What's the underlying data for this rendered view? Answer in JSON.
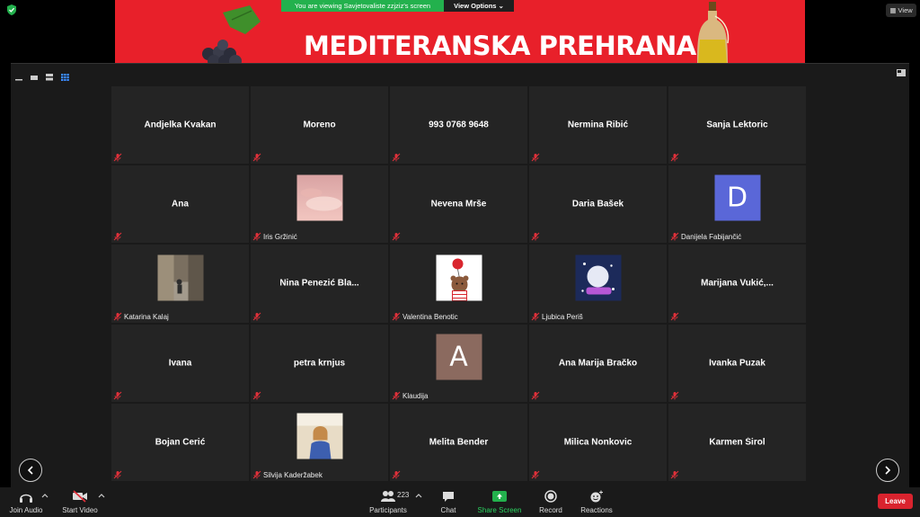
{
  "share": {
    "viewing_text": "You are viewing Savjetovaliste zzjziz's screen",
    "view_options": "View Options",
    "slide_title": "MEDITERANSKA PREHRANA",
    "view_button": "View"
  },
  "participants": [
    {
      "name": "Andjelka Kvakan"
    },
    {
      "name": "Moreno"
    },
    {
      "name": "993 0768 9648"
    },
    {
      "name": "Nermina Ribić"
    },
    {
      "name": "Sanja Lektoric"
    },
    {
      "name": "Ana"
    },
    {
      "label": "Iris Gržinić",
      "photo": "pink-sky"
    },
    {
      "name": "Nevena Mrše"
    },
    {
      "name": "Daria Bašek"
    },
    {
      "label": "Danijela Fabijančić",
      "avatar": "D",
      "avatar_color": "#5a67d8"
    },
    {
      "label": "Katarina Kalaj",
      "photo": "street"
    },
    {
      "name": "Nina Penezić Bla..."
    },
    {
      "label": "Valentina Benotic",
      "photo": "bear-balloon"
    },
    {
      "label": "Ljubica Periš",
      "photo": "sparkle"
    },
    {
      "name": "Marijana Vukić,..."
    },
    {
      "name": "Ivana"
    },
    {
      "name": "petra krnjus"
    },
    {
      "label": "Klaudija",
      "avatar": "A",
      "avatar_color": "#8b6a5f"
    },
    {
      "name": "Ana Marija Bračko"
    },
    {
      "name": "Ivanka Puzak"
    },
    {
      "name": "Bojan Cerić"
    },
    {
      "label": "Silvija Kaderžabek",
      "photo": "portrait"
    },
    {
      "name": "Melita Bender"
    },
    {
      "name": "Milica Nonkovic"
    },
    {
      "name": "Karmen Širol"
    }
  ],
  "toolbar": {
    "join_audio": "Join Audio",
    "start_video": "Start Video",
    "participants": "Participants",
    "participant_count": "223",
    "chat": "Chat",
    "share_screen": "Share Screen",
    "record": "Record",
    "reactions": "Reactions",
    "leave": "Leave"
  },
  "colors": {
    "share_green": "#23b14d",
    "leave_red": "#d9232e",
    "banner_red": "#e8202a",
    "mute_red": "#e0303a"
  }
}
